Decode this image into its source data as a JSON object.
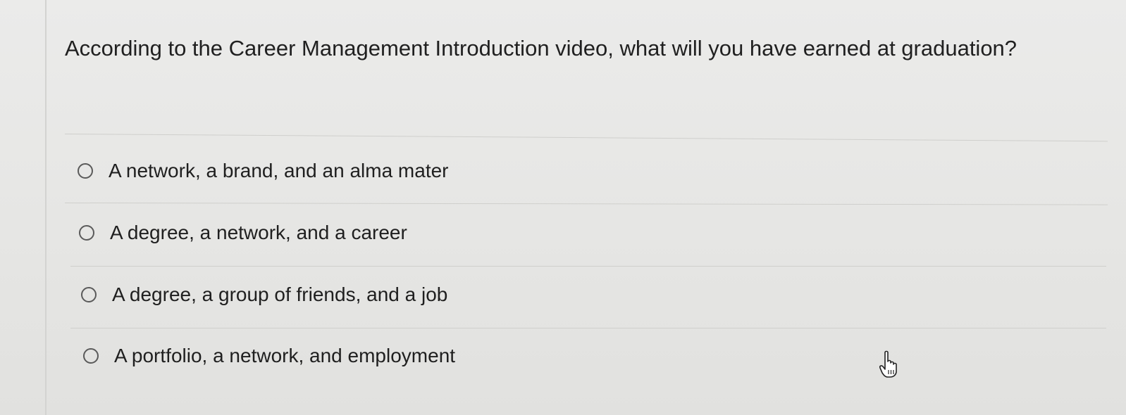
{
  "question": {
    "text": "According to the Career Management Introduction video, what will you have earned at graduation?"
  },
  "options": [
    {
      "label": "A network, a brand, and an alma mater",
      "selected": false
    },
    {
      "label": "A degree, a network, and a career",
      "selected": false
    },
    {
      "label": "A degree, a group of friends, and a job",
      "selected": false
    },
    {
      "label": "A portfolio, a network, and employment",
      "selected": false
    }
  ],
  "cursor": {
    "icon": "hand-pointer-icon"
  }
}
